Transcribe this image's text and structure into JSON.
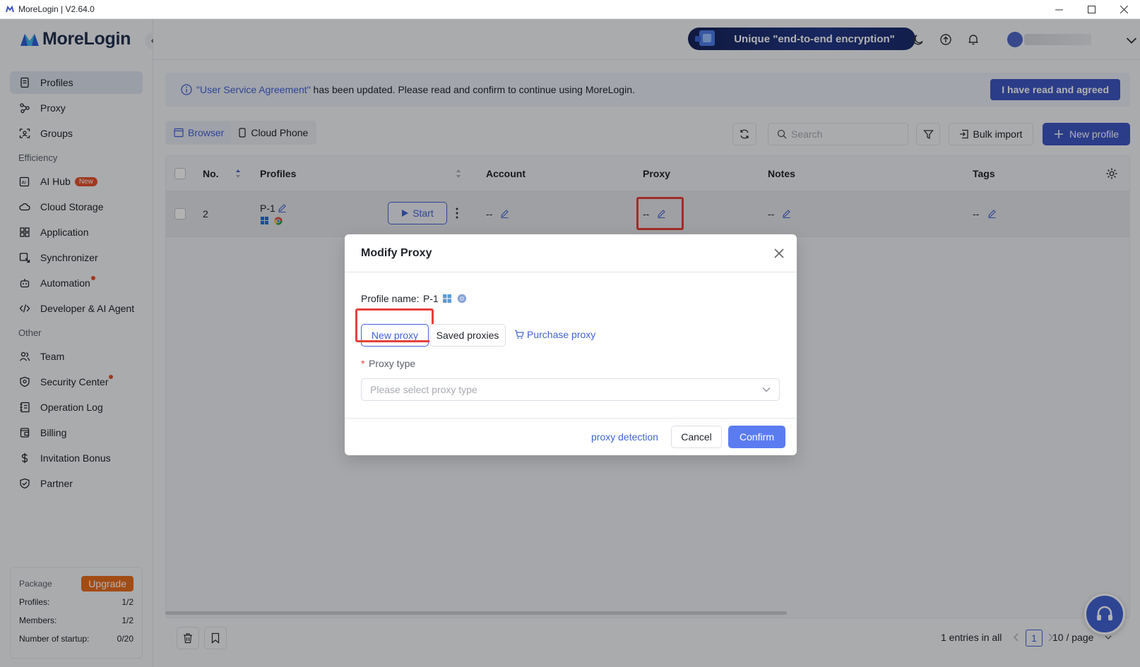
{
  "window": {
    "title": "MoreLogin | V2.64.0"
  },
  "brand": {
    "name": "MoreLogin",
    "accent": "#3e56c4",
    "highlight": "#e5413b"
  },
  "sidebar": {
    "main_items": [
      {
        "label": "Profiles",
        "icon": "document-icon",
        "active": true
      },
      {
        "label": "Proxy",
        "icon": "proxy-icon"
      },
      {
        "label": "Groups",
        "icon": "groups-icon"
      }
    ],
    "efficiency_label": "Efficiency",
    "efficiency_items": [
      {
        "label": "AI Hub",
        "icon": "ai-hub-icon",
        "badge": "New"
      },
      {
        "label": "Cloud Storage",
        "icon": "cloud-icon"
      },
      {
        "label": "Application",
        "icon": "grid-icon"
      },
      {
        "label": "Synchronizer",
        "icon": "sync-icon"
      },
      {
        "label": "Automation",
        "icon": "robot-icon",
        "dot": true
      },
      {
        "label": "Developer & AI Agent",
        "icon": "code-icon"
      }
    ],
    "other_label": "Other",
    "other_items": [
      {
        "label": "Team",
        "icon": "team-icon"
      },
      {
        "label": "Security Center",
        "icon": "shield-icon",
        "dot": true
      },
      {
        "label": "Operation Log",
        "icon": "log-icon"
      },
      {
        "label": "Billing",
        "icon": "billing-icon"
      },
      {
        "label": "Invitation Bonus",
        "icon": "dollar-icon"
      },
      {
        "label": "Partner",
        "icon": "partner-icon"
      }
    ],
    "package": {
      "label": "Package",
      "upgrade": "Upgrade",
      "profiles_label": "Profiles:",
      "profiles_value": "1/2",
      "members_label": "Members:",
      "members_value": "1/2",
      "startup_label": "Number of startup:",
      "startup_value": "0/20"
    }
  },
  "header": {
    "promo": "Unique \"end-to-end encryption\""
  },
  "notice": {
    "link": "\"User Service Agreement\"",
    "text": " has been updated. Please read and confirm to continue using MoreLogin.",
    "agree": "I have read and agreed"
  },
  "tabs": {
    "browser": "Browser",
    "cloud_phone": "Cloud Phone"
  },
  "toolbar": {
    "search_placeholder": "Search",
    "bulk_import": "Bulk import",
    "new_profile": "New profile"
  },
  "table": {
    "columns": {
      "no": "No.",
      "profiles": "Profiles",
      "account": "Account",
      "proxy": "Proxy",
      "notes": "Notes",
      "tags": "Tags"
    },
    "rows": [
      {
        "no": "2",
        "name": "P-1",
        "start": "Start",
        "account": "--",
        "proxy": "--",
        "notes": "--",
        "tags": "--"
      }
    ]
  },
  "footer": {
    "entries": "1 entries in all",
    "page": "1",
    "page_size": "10 / page"
  },
  "modal": {
    "title": "Modify Proxy",
    "profile_label": "Profile name:",
    "profile_name": "P-1",
    "new_proxy": "New proxy",
    "saved_proxies": "Saved proxies",
    "purchase_proxy": "Purchase proxy",
    "required_mark": "*",
    "proxy_type_label": "Proxy type",
    "proxy_type_placeholder": "Please select proxy type",
    "detection": "proxy detection",
    "cancel": "Cancel",
    "confirm": "Confirm"
  }
}
